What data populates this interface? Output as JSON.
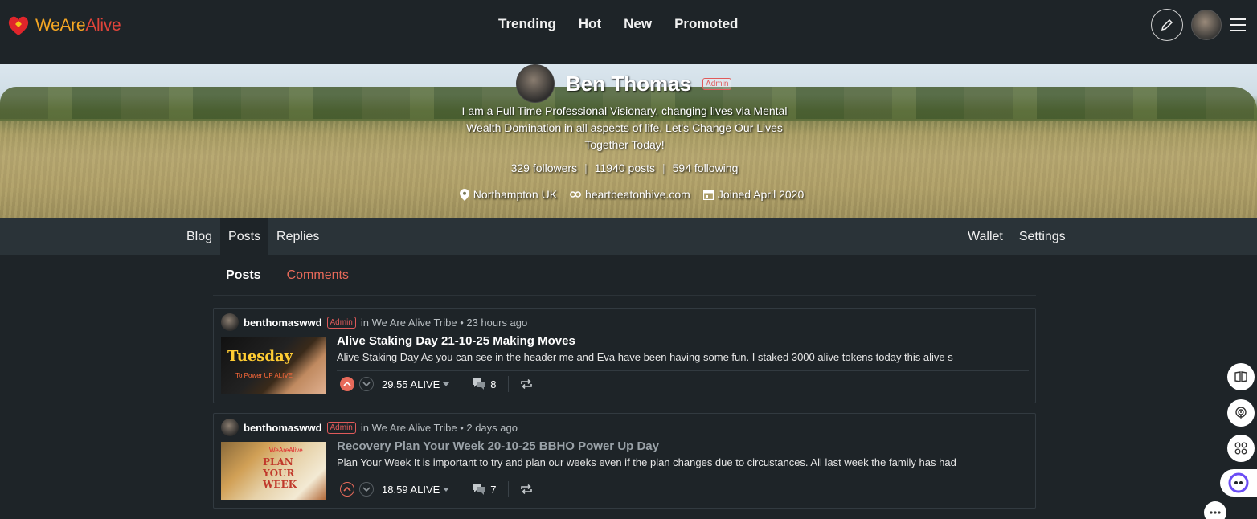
{
  "header": {
    "brand": {
      "we": "We",
      "are": "Are",
      "alive": "Alive"
    },
    "nav": [
      "Trending",
      "Hot",
      "New",
      "Promoted"
    ],
    "accent": "#e86a5a"
  },
  "profile": {
    "name": "Ben Thomas",
    "badge": "Admin",
    "about": "I am a Full Time Professional Visionary, changing lives via Mental Wealth Domination in all aspects of life. Let's Change Our Lives Together Today!",
    "followers": "329 followers",
    "posts": "11940 posts",
    "following": "594 following",
    "location": "Northampton UK",
    "website": "heartbeatonhive.com",
    "joined": "Joined April 2020"
  },
  "profile_nav": {
    "left": [
      "Blog",
      "Posts",
      "Replies"
    ],
    "right": [
      "Wallet",
      "Settings"
    ],
    "active": "Posts"
  },
  "subtabs": {
    "posts": "Posts",
    "comments": "Comments"
  },
  "posts": [
    {
      "author": "benthomaswwd",
      "badge": "Admin",
      "meta": "in We Are Alive Tribe • 23 hours ago",
      "title": "Alive Staking Day 21-10-25 Making Moves",
      "excerpt": "Alive Staking Day As you can see in the header me and Eva have been having some fun. I staked 3000 alive tokens today this alive s",
      "payout": "29.55 ALIVE",
      "comments": "8",
      "thumb_text": "Tuesday",
      "thumb_sub": "To Power UP ALIVE"
    },
    {
      "author": "benthomaswwd",
      "badge": "Admin",
      "meta": "in We Are Alive Tribe • 2 days ago",
      "title": "Recovery Plan Your Week 20-10-25 BBHO Power Up Day",
      "excerpt": "Plan Your Week It is important to try and plan our weeks even if the plan changes due to circustances. All last week the family has had",
      "payout": "18.59 ALIVE",
      "comments": "7",
      "thumb_text": "PLAN YOUR WEEK",
      "thumb_sub": "WeAreAlive"
    }
  ]
}
